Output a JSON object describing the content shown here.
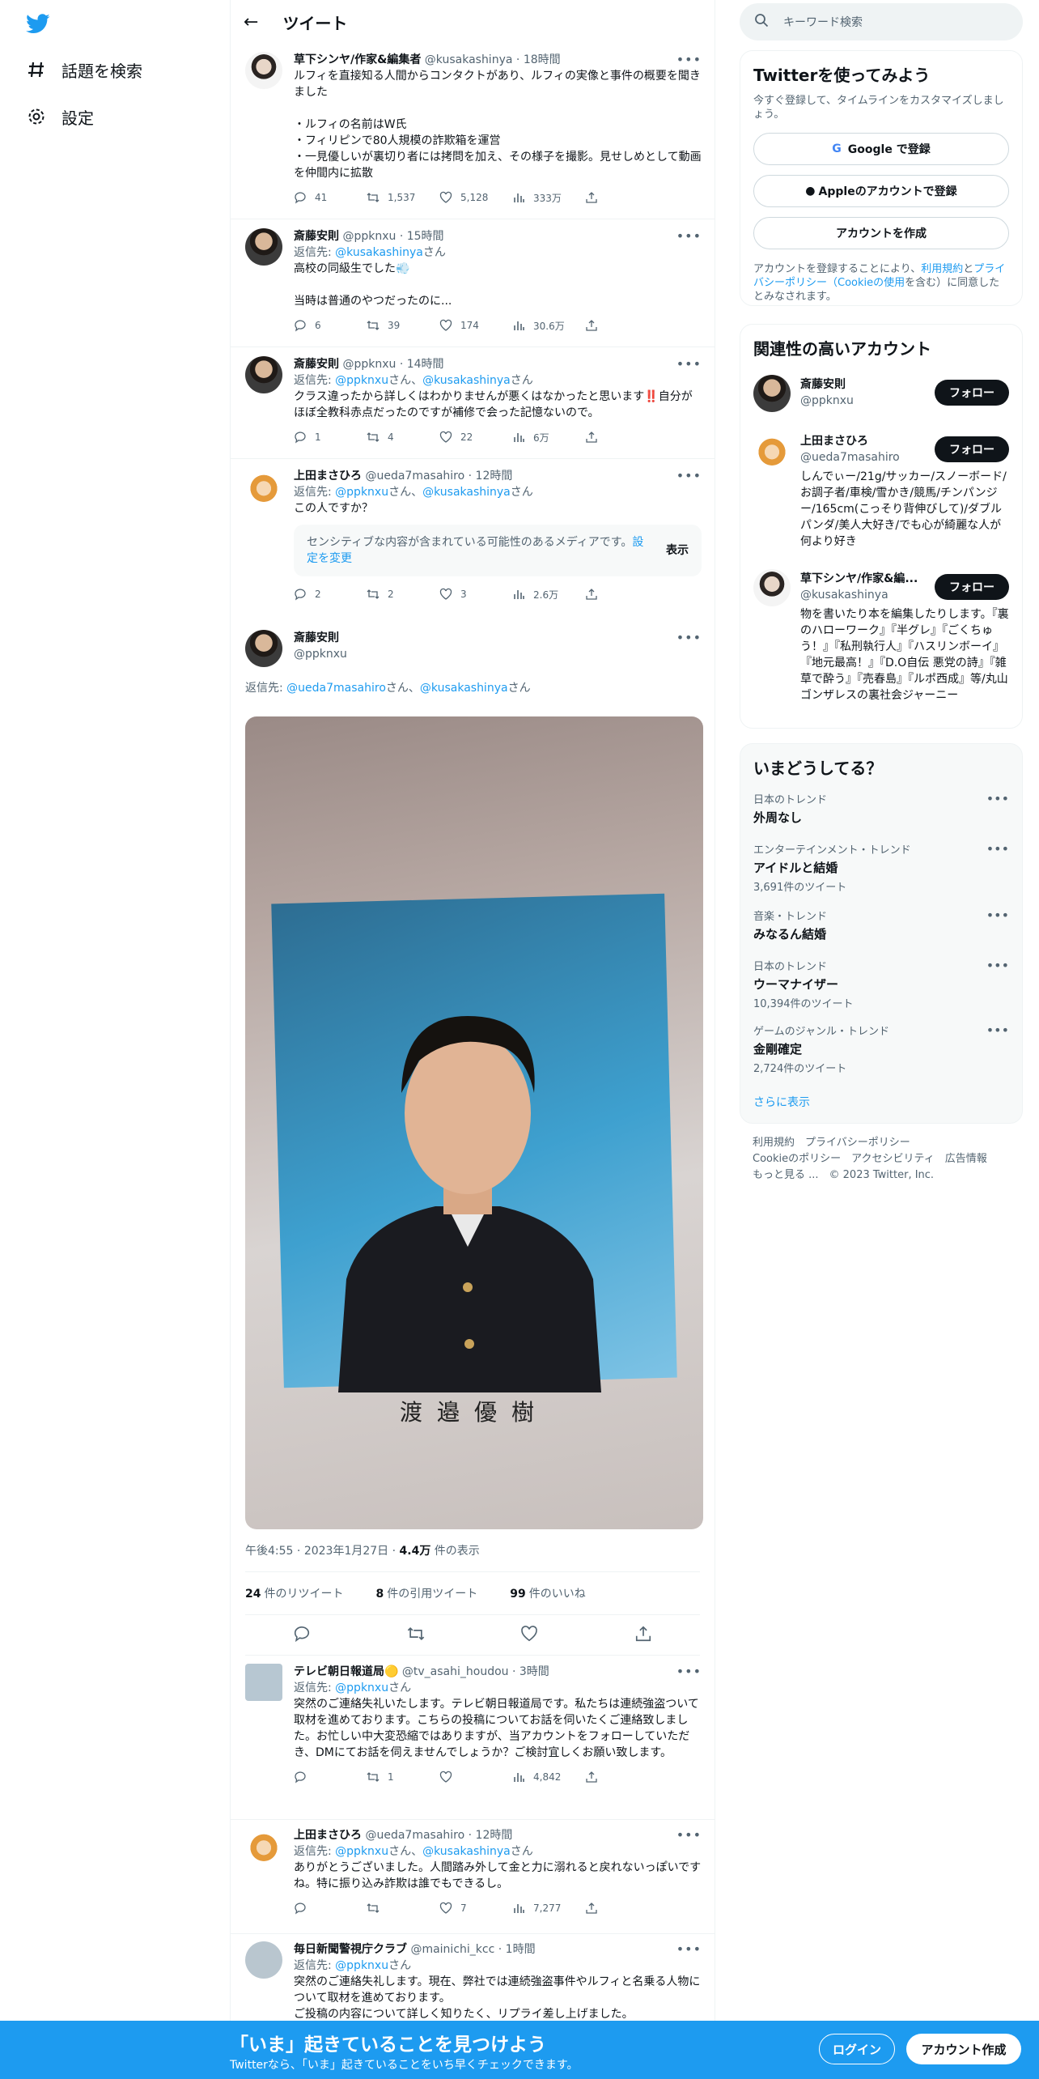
{
  "nav": {
    "explore": "話題を検索",
    "settings": "設定"
  },
  "header": {
    "title": "ツイート",
    "back": "←"
  },
  "tweets": [
    {
      "name": "草下シンヤ/作家&編集者",
      "handle": "@kusakashinya",
      "time": "18時間",
      "text": "ルフィを直接知る人間からコンタクトがあり、ルフィの実像と事件の概要を聞きました\n\n・ルフィの名前はW氏\n・フィリピンで80人規模の詐欺箱を運営\n・一見優しいが裏切り者には拷問を加え、その様子を撮影。見せしめとして動画を仲間内に拡散",
      "replies": "41",
      "retweets": "1,537",
      "likes": "5,128",
      "views": "333万"
    },
    {
      "name": "斎藤安則",
      "handle": "@ppknxu",
      "time": "15時間",
      "reply_to_prefix": "返信先: ",
      "reply_to": "@kusakashinya",
      "reply_suffix": "さん",
      "text": "高校の同級生でした💨\n\n当時は普通のやつだったのに...",
      "replies": "6",
      "retweets": "39",
      "likes": "174",
      "views": "30.6万"
    },
    {
      "name": "斎藤安則",
      "handle": "@ppknxu",
      "time": "14時間",
      "reply_to_prefix": "返信先: ",
      "reply_to": "@ppknxu",
      "reply_mid": "さん、",
      "reply_to2": "@kusakashinya",
      "reply_suffix": "さん",
      "text": "クラス違ったから詳しくはわかりませんが悪くはなかったと思います‼️自分がほぼ全教科赤点だったのですが補修で会った記憶ないので。",
      "replies": "1",
      "retweets": "4",
      "likes": "22",
      "views": "6万"
    },
    {
      "name": "上田まさひろ",
      "handle": "@ueda7masahiro",
      "time": "12時間",
      "reply_to_prefix": "返信先: ",
      "reply_to": "@ppknxu",
      "reply_mid": "さん、",
      "reply_to2": "@kusakashinya",
      "reply_suffix": "さん",
      "text": "この人ですか？",
      "sensitive": "センシティブな内容が含まれている可能性のあるメディアです。",
      "sensitive_link": "設定を変更",
      "show": "表示",
      "replies": "2",
      "retweets": "2",
      "likes": "3",
      "views": "2.6万"
    }
  ],
  "main_tweet": {
    "name": "斎藤安則",
    "handle": "@ppknxu",
    "reply_to_prefix": "返信先: ",
    "reply_to": "@ueda7masahiro",
    "reply_mid": "さん、",
    "reply_to2": "@kusakashinya",
    "reply_suffix": "さん",
    "photo_caption": "渡邉優樹",
    "time": "午後4:55",
    "date": "2023年1月27日",
    "views_num": "4.4万",
    "views_label": "件の表示",
    "retweets": "24",
    "retweets_label": "件のリツイート",
    "quotes": "8",
    "quotes_label": "件の引用ツイート",
    "likes": "99",
    "likes_label": "件のいいね"
  },
  "replies": [
    {
      "name": "テレビ朝日報道局",
      "badge": "🟡",
      "handle": "@tv_asahi_houdou",
      "time": "3時間",
      "reply_to_prefix": "返信先: ",
      "reply_to": "@ppknxu",
      "reply_suffix": "さん",
      "text": "突然のご連絡失礼いたします。テレビ朝日報道局です。私たちは連続強盗ついて取材を進めております。こちらの投稿についてお話を伺いたくご連絡致しました。お忙しい中大変恐縮ではありますが、当アカウントをフォローしていただき、DMにてお話を伺えませんでしょうか？ご検討宜しくお願い致します。",
      "replies": "",
      "retweets": "1",
      "likes": "",
      "views": "4,842"
    },
    {
      "name": "上田まさひろ",
      "handle": "@ueda7masahiro",
      "time": "12時間",
      "reply_to_prefix": "返信先: ",
      "reply_to": "@ppknxu",
      "reply_mid": "さん、",
      "reply_to2": "@kusakashinya",
      "reply_suffix": "さん",
      "text": "ありがとうございました。人間踏み外して金と力に溺れると戻れないっぽいですね。特に振り込み詐欺は誰でもできるし。",
      "replies": "",
      "retweets": "",
      "likes": "7",
      "views": "7,277"
    },
    {
      "name": "毎日新聞警視庁クラブ",
      "handle": "@mainichi_kcc",
      "time": "1時間",
      "reply_to_prefix": "返信先: ",
      "reply_to": "@ppknxu",
      "reply_suffix": "さん",
      "text": "突然のご連絡失礼します。現在、弊社では連続強盗事件やルフィと名乗る人物について取材を進めております。\nご投稿の内容について詳しく知りたく、リプライ差し上げました。"
    }
  ],
  "search": {
    "placeholder": "キーワード検索"
  },
  "signup_box": {
    "title": "Twitterを使ってみよう",
    "desc": "今すぐ登録して、タイムラインをカスタマイズしましょう。",
    "google": "Google で登録",
    "apple": "Appleのアカウントで登録",
    "create": "アカウントを作成",
    "terms_a": "アカウントを登録することにより、",
    "terms_link1": "利用規約",
    "terms_b": "と",
    "terms_link2": "プライバシーポリシー（Cookieの使用",
    "terms_c": "を含む）に同意したとみなされます。"
  },
  "related": {
    "title": "関連性の高いアカウント",
    "follow": "フォロー",
    "users": [
      {
        "name": "斎藤安則",
        "handle": "@ppknxu",
        "bio": ""
      },
      {
        "name": "上田まさひろ",
        "handle": "@ueda7masahiro",
        "bio": "しんでぃー/21g/サッカー/スノーボード/お調子者/車検/雪かき/競馬/チンパンジー/165cm(こっそり背伸びして)/ダブルパンダ/美人大好き/でも心が綺麗な人が何より好き"
      },
      {
        "name": "草下シンヤ/作家&編...",
        "handle": "@kusakashinya",
        "bio": "物を書いたり本を編集したりします。『裏のハローワーク』『半グレ』『ごくちゅう！』『私刑執行人』『ハスリンボーイ』『地元最高！』『D.O自伝 悪党の詩』『雑草で酔う』『売春島』『ルポ西成』等/丸山ゴンザレスの裏社会ジャーニー"
      }
    ]
  },
  "trends": {
    "title": "いまどうしてる？",
    "items": [
      {
        "category": "日本のトレンド",
        "name": "外周なし",
        "count": ""
      },
      {
        "category": "エンターテインメント・トレンド",
        "name": "アイドルと結婚",
        "count": "3,691件のツイート"
      },
      {
        "category": "音楽・トレンド",
        "name": "みなるん結婚",
        "count": ""
      },
      {
        "category": "日本のトレンド",
        "name": "ウーマナイザー",
        "count": "10,394件のツイート"
      },
      {
        "category": "ゲームのジャンル・トレンド",
        "name": "金剛確定",
        "count": "2,724件のツイート"
      }
    ],
    "more": "さらに表示"
  },
  "footer": {
    "line1": "利用規約　プライバシーポリシー",
    "line2": "Cookieのポリシー　アクセシビリティ　広告情報",
    "line3": "もっと見る ...　© 2023 Twitter, Inc."
  },
  "bottom": {
    "headline": "「いま」起きていることを見つけよう",
    "sub": "Twitterなら、「いま」起きていることをいち早くチェックできます。",
    "login": "ログイン",
    "signup": "アカウント作成"
  },
  "colors": {
    "brand": "#1d9bf0",
    "text": "#0f1419",
    "muted": "#536471"
  }
}
